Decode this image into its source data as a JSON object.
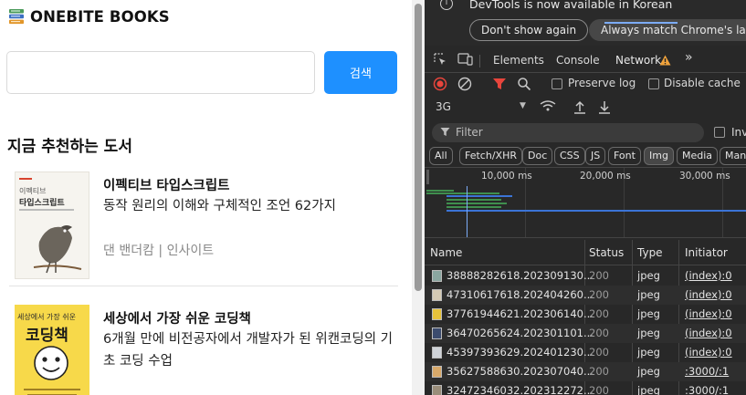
{
  "page": {
    "brand": {
      "title": "ONEBITE BOOKS",
      "icon": "books-icon"
    },
    "search": {
      "placeholder": "",
      "value": "",
      "button_label": "검색"
    },
    "section_title": "지금 추천하는 도서",
    "books": [
      {
        "title": "이펙티브 타입스크립트",
        "subtitle": "동작 원리의 이해와 구체적인 조언 62가지",
        "author": "댄 밴더캄 | 인사이트",
        "cover_text": {
          "small": "이펙티브",
          "big": "타입스크립트"
        }
      },
      {
        "title": "세상에서 가장 쉬운 코딩책",
        "subtitle": "6개월 만에 비전공자에서 개발자가 된 위캔코딩의 기초 코딩 수업",
        "author": "",
        "cover_text": {
          "small": "세상에서 가장 쉬운",
          "big": "코딩책"
        }
      }
    ]
  },
  "devtools": {
    "banner": {
      "message": "DevTools is now available in Korean",
      "dont_show": "Don't show again",
      "always_match": "Always match Chrome's langu"
    },
    "tabs": [
      "Elements",
      "Console",
      "Network"
    ],
    "active_tab": "Network",
    "toolbar": {
      "preserve_log": "Preserve log",
      "disable_cache": "Disable cache"
    },
    "throttle": "3G",
    "filter": {
      "placeholder": "Filter",
      "invert_label": "Inv"
    },
    "type_filters": [
      "All",
      "Fetch/XHR",
      "Doc",
      "CSS",
      "JS",
      "Font",
      "Img",
      "Media",
      "Man"
    ],
    "active_type": "Img",
    "timeline_labels": [
      "10,000 ms",
      "20,000 ms",
      "30,000 ms"
    ],
    "columns": [
      "Name",
      "Status",
      "Type",
      "Initiator"
    ],
    "rows": [
      {
        "name": "38888282618.202309130...",
        "status": "200",
        "type": "jpeg",
        "initiator": "(index):0"
      },
      {
        "name": "47310617618.202404260...",
        "status": "200",
        "type": "jpeg",
        "initiator": "(index):0"
      },
      {
        "name": "37761944621.202306140...",
        "status": "200",
        "type": "jpeg",
        "initiator": "(index):0"
      },
      {
        "name": "36470265624.202301101...",
        "status": "200",
        "type": "jpeg",
        "initiator": "(index):0"
      },
      {
        "name": "45397393629.202401230...",
        "status": "200",
        "type": "jpeg",
        "initiator": "(index):0"
      },
      {
        "name": "35627588630.202307040...",
        "status": "200",
        "type": "jpeg",
        "initiator": ":3000/:1"
      },
      {
        "name": "32472346032.202312272...",
        "status": "200",
        "type": "jpeg",
        "initiator": ":3000/:1"
      }
    ],
    "colors": {
      "accent": "#7cacf8",
      "warning": "#f0a33c",
      "record": "#e8453c",
      "filter_active": "#e8453c"
    }
  }
}
